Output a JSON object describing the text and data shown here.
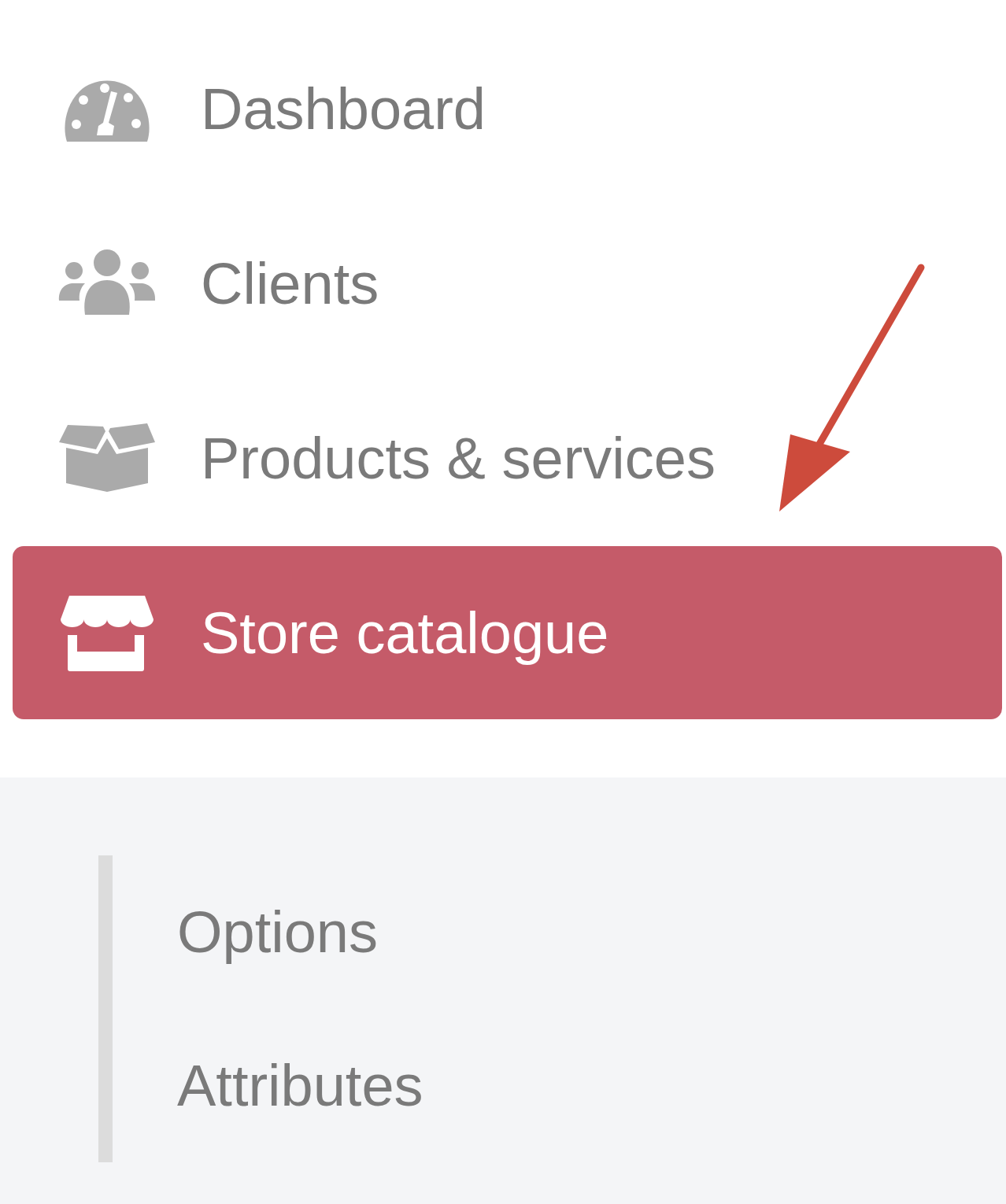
{
  "nav": {
    "items": [
      {
        "label": "Dashboard",
        "selected": false
      },
      {
        "label": "Clients",
        "selected": false
      },
      {
        "label": "Products & services",
        "selected": false
      },
      {
        "label": "Store catalogue",
        "selected": true
      }
    ]
  },
  "submenu": {
    "items": [
      {
        "label": "Options",
        "selected": false
      },
      {
        "label": "Attributes",
        "selected": false
      }
    ]
  },
  "annotations": [
    {
      "kind": "arrow"
    }
  ]
}
